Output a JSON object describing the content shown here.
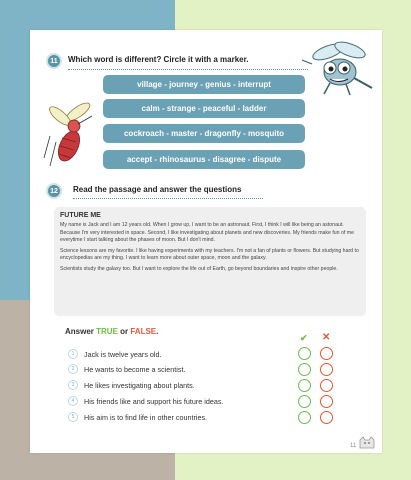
{
  "task11": {
    "number": "11",
    "title": "Which word is different?  Circle it with a marker.",
    "rows": [
      "village - journey - genius - interrupt",
      "calm - strange - peaceful - ladder",
      "cockroach - master - dragonfly - mosquito",
      "accept - rhinosaurus - disagree - dispute"
    ]
  },
  "task12": {
    "number": "12",
    "title": "Read the passage and answer the questions"
  },
  "passage": {
    "title": "FUTURE ME",
    "paragraphs": [
      "My name is Jack and I am 12 years old. When I grow up, I want to be an astronaut. First, I think I will like being an astonaut. Because I'm very interested in space. Second, I like investigating about planets and new discoveries. My friends make fun of me everytime I start talking about the phases of moon. But I don't mind.",
      "Science lessons are my favorite. I like having experiments with my teachers. I'm not a fan of plants or flowers. But studying hard to encyclopedias are my thing. I want  to learn more about outer space, moon and the galaxy.",
      "Scientists study the galaxy too. But I want to explore the life out of Earth, go beyond boundaries and inspire other people."
    ]
  },
  "true_false": {
    "heading_prefix": "Answer ",
    "true_word": "TRUE",
    "or_word": " or ",
    "false_word": "FALSE",
    "period": ".",
    "check_mark": "✔",
    "cross_mark": "✕",
    "statements": [
      {
        "num": "1",
        "text": "Jack is twelve years old."
      },
      {
        "num": "2",
        "text": "He wants to become a scientist."
      },
      {
        "num": "3",
        "text": "He likes investigating about plants."
      },
      {
        "num": "4",
        "text": "His friends like and support his future ideas."
      },
      {
        "num": "5",
        "text": "His aim is to find life in other countries."
      }
    ]
  },
  "page_number": "11",
  "colors": {
    "accent_blue": "#6aa1b4",
    "true_green": "#6dbe45",
    "false_red": "#e25a3a"
  },
  "illustrations": [
    "dragonfly-illustration",
    "mosquito-illustration",
    "cat-doodle-icon"
  ]
}
